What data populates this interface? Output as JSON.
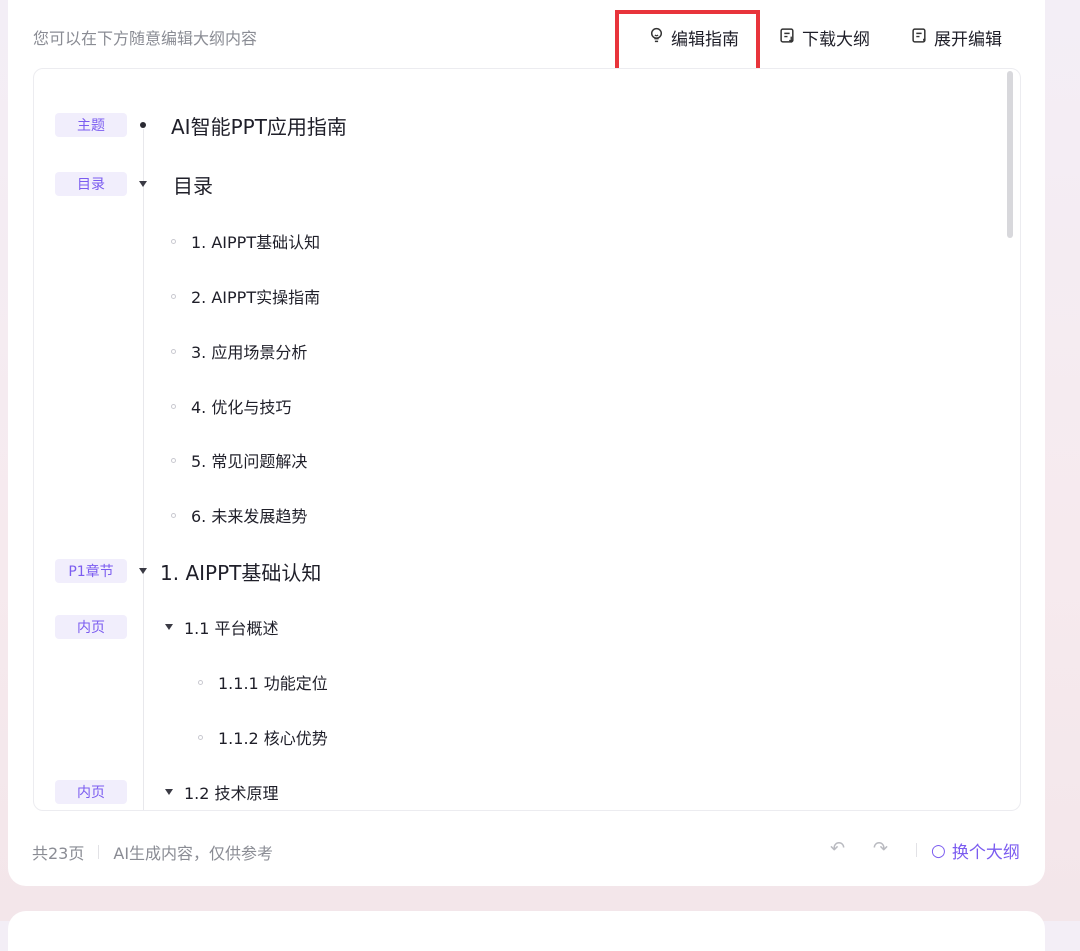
{
  "header": {
    "hint": "您可以在下方随意编辑大纲内容",
    "edit_guide": "编辑指南",
    "download_outline": "下载大纲",
    "expand_edit": "展开编辑"
  },
  "outline": {
    "tags": {
      "topic": "主题",
      "toc": "目录",
      "chapter": "P1章节",
      "inner1": "内页",
      "inner2": "内页"
    },
    "topic_title": "AI智能PPT应用指南",
    "toc_title": "目录",
    "toc_items": [
      "1.  AIPPT基础认知",
      "2.  AIPPT实操指南",
      "3.  应用场景分析",
      "4.  优化与技巧",
      "5.  常见问题解决",
      "6.  未来发展趋势"
    ],
    "chapter_title": "1.  AIPPT基础认知",
    "section_1": "1.1   平台概述",
    "sub_1": "1.1.1   功能定位",
    "sub_2": "1.1.2   核心优势",
    "section_2": "1.2   技术原理"
  },
  "footer": {
    "pages": "共23页",
    "disclaimer": "AI生成内容，仅供参考",
    "undo_icon": "↶",
    "redo_icon": "↷",
    "refresh_icon": "○",
    "refresh_label": "换个大纲"
  }
}
